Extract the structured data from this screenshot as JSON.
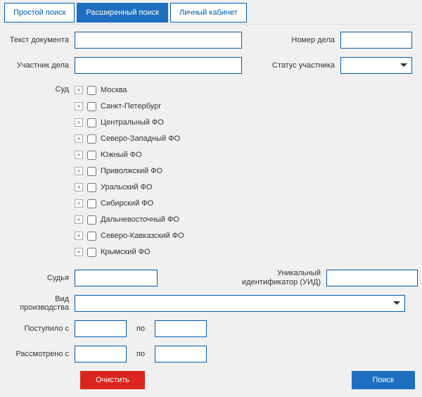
{
  "tabs": {
    "simple": "Простой поиск",
    "advanced": "Расширенный поиск",
    "cabinet": "Личный кабинет"
  },
  "labels": {
    "doc_text": "Текст документа",
    "case_number": "Номер дела",
    "participant": "Участник дела",
    "participant_status": "Статус участника",
    "court": "Суд",
    "judge": "Судья",
    "uid": "Уникальный идентификатор (УИД)",
    "procedure_type": "Вид производства",
    "received_from": "Поступило с",
    "reviewed_from": "Рассмотрено с",
    "to": "по"
  },
  "courts": [
    "Москва",
    "Санкт-Петербург",
    "Центральный ФО",
    "Северо-Западный ФО",
    "Южный ФО",
    "Приволжский ФО",
    "Уральский ФО",
    "Сибирский ФО",
    "Дальневосточный ФО",
    "Северо-Кавказский ФО",
    "Крымский ФО"
  ],
  "buttons": {
    "clear": "Очистить",
    "search": "Поиск"
  },
  "values": {
    "doc_text": "",
    "case_number": "",
    "participant": "",
    "participant_status": "",
    "judge": "",
    "uid": "",
    "procedure_type": "",
    "received_from": "",
    "received_to": "",
    "reviewed_from": "",
    "reviewed_to": ""
  }
}
